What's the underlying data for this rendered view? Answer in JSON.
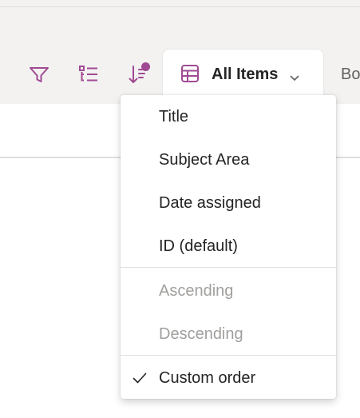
{
  "toolbar": {
    "filter_icon": "filter-icon",
    "edit_icon": "edit-columns-icon",
    "sort_icon": "sort-icon",
    "view_icon": "grid-icon",
    "view_label": "All Items",
    "overflow_label": "Bo"
  },
  "sort_menu": {
    "fields": [
      {
        "label": "Title"
      },
      {
        "label": "Subject Area"
      },
      {
        "label": "Date assigned"
      },
      {
        "label": "ID (default)"
      }
    ],
    "directions": [
      {
        "label": "Ascending",
        "enabled": false
      },
      {
        "label": "Descending",
        "enabled": false
      }
    ],
    "custom": {
      "label": "Custom order",
      "checked": true
    }
  },
  "colors": {
    "accent": "#a04a93",
    "background_band": "#f3f2f1",
    "disabled_text": "#a19f9d"
  }
}
